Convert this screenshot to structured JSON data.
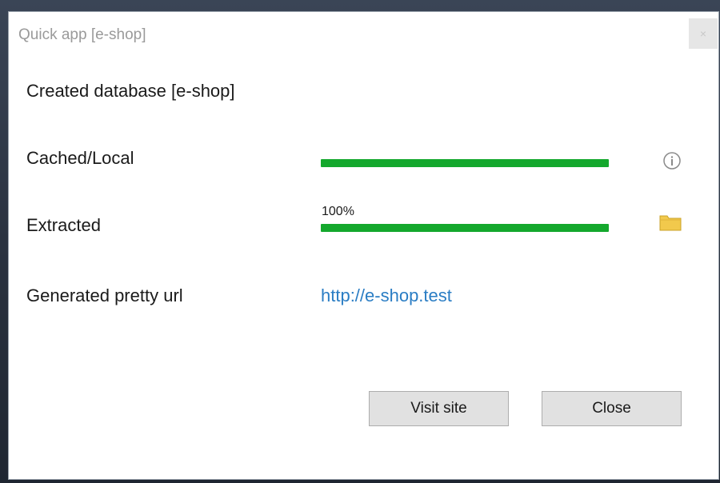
{
  "window": {
    "title": "Quick app [e-shop]",
    "close_glyph": "×"
  },
  "status": {
    "message": "Created database [e-shop]"
  },
  "rows": {
    "cached": {
      "label": "Cached/Local",
      "progress_percent": 100,
      "icon": "info-icon"
    },
    "extracted": {
      "label": "Extracted",
      "progress_text": "100%",
      "progress_percent": 100,
      "icon": "folder-icon"
    },
    "pretty_url": {
      "label": "Generated pretty url",
      "url": "http://e-shop.test"
    }
  },
  "buttons": {
    "visit_label": "Visit site",
    "close_label": "Close"
  },
  "colors": {
    "progress": "#14a82d",
    "link": "#2a7dc4",
    "folder": "#f2c94c"
  }
}
